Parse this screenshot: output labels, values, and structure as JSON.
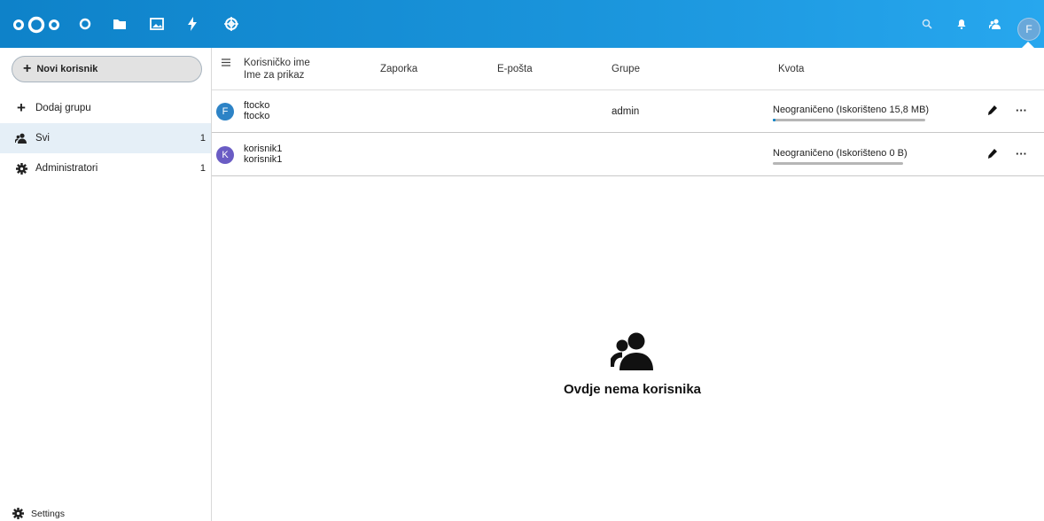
{
  "header": {
    "apps": [
      "dashboard",
      "files",
      "photos",
      "activity",
      "help"
    ],
    "avatar_initial": "F"
  },
  "sidebar": {
    "new_user_label": "Novi korisnik",
    "add_group_label": "Dodaj grupu",
    "items": [
      {
        "label": "Svi",
        "count": "1"
      },
      {
        "label": "Administratori",
        "count": "1"
      }
    ],
    "settings_label": "Settings"
  },
  "table": {
    "headers": {
      "username": "Korisničko ime",
      "display_name": "Ime za prikaz",
      "password": "Zaporka",
      "email": "E-pošta",
      "groups": "Grupe",
      "quota": "Kvota"
    },
    "rows": [
      {
        "initial": "F",
        "avatar_color": "#2d83c6",
        "username": "ftocko",
        "display_name": "ftocko",
        "groups": "admin",
        "quota_text": "Neograničeno (Iskorišteno 15,8 MB)",
        "quota_fill": 0.02
      },
      {
        "initial": "K",
        "avatar_color": "#6a5cc4",
        "username": "korisnik1",
        "display_name": "korisnik1",
        "groups": "",
        "quota_text": "Neograničeno (Iskorišteno 0 B)",
        "quota_fill": 0
      }
    ]
  },
  "empty_state": {
    "message": "Ovdje nema korisnika"
  },
  "colors": {
    "header": "#1a94db",
    "active_nav": "#e5eff7",
    "quota_bar": "#b6b6b6"
  }
}
